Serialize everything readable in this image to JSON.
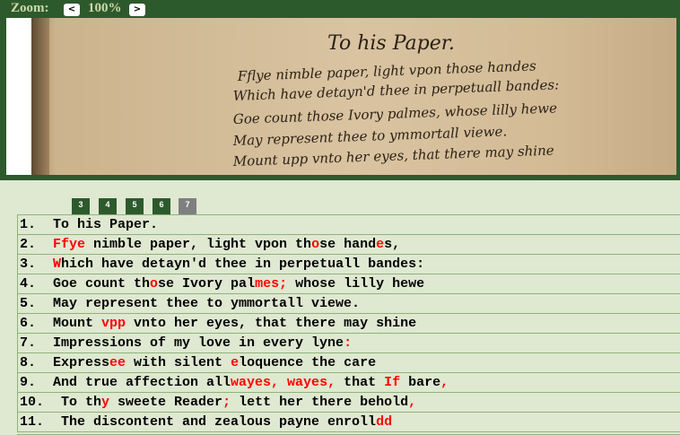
{
  "zoom": {
    "label": "Zoom:",
    "decrease": "<",
    "value": "100%",
    "increase": ">"
  },
  "manuscript": {
    "title": "To his Paper.",
    "handwriting": [
      "Fflye nimble paper, light vpon those handes",
      "Which have detayn'd thee in perpetuall bandes:",
      "Goe count those Ivory palmes, whose lilly hewe",
      "May represent thee to ymmortall viewe.",
      "Mount upp vnto her eyes, that there may shine"
    ]
  },
  "pages": [
    "3",
    "4",
    "5",
    "6",
    "7"
  ],
  "active_page": "7",
  "colors": {
    "toolbar": "#2d5a2d",
    "background": "#dfe8d1",
    "rule": "#8fb478",
    "edit": "#ff0000"
  },
  "lines": [
    {
      "num": "1.",
      "segs": [
        {
          "t": "To his Paper."
        }
      ]
    },
    {
      "num": "2.",
      "segs": [
        {
          "t": "Ffye",
          "r": true
        },
        {
          "t": " nimble paper, light vpon th"
        },
        {
          "t": "o",
          "r": true
        },
        {
          "t": "se hand"
        },
        {
          "t": "e",
          "r": true
        },
        {
          "t": "s,"
        }
      ]
    },
    {
      "num": "3.",
      "segs": [
        {
          "t": "W",
          "r": true
        },
        {
          "t": "hich have detayn'd thee in perpetuall bandes:"
        }
      ]
    },
    {
      "num": "4.",
      "segs": [
        {
          "t": "Goe count th"
        },
        {
          "t": "o",
          "r": true
        },
        {
          "t": "se Ivory pal"
        },
        {
          "t": "mes;",
          "r": true
        },
        {
          "t": " whose lilly hewe"
        }
      ]
    },
    {
      "num": "5.",
      "segs": [
        {
          "t": "May represent thee to ymmortall viewe."
        }
      ]
    },
    {
      "num": "6.",
      "segs": [
        {
          "t": "Mount "
        },
        {
          "t": "vpp",
          "r": true
        },
        {
          "t": " vnto her eyes, that there may shine"
        }
      ]
    },
    {
      "num": "7.",
      "segs": [
        {
          "t": "Impressions of my love in every lyne"
        },
        {
          "t": ":",
          "r": true
        }
      ]
    },
    {
      "num": "8.",
      "segs": [
        {
          "t": "Express"
        },
        {
          "t": "ee",
          "r": true
        },
        {
          "t": " with silent "
        },
        {
          "t": "e",
          "r": true
        },
        {
          "t": "loquence the care"
        }
      ]
    },
    {
      "num": "9.",
      "segs": [
        {
          "t": "And true affection all"
        },
        {
          "t": "wayes, wayes,",
          "r": true
        },
        {
          "t": " that "
        },
        {
          "t": "If",
          "r": true
        },
        {
          "t": " bare"
        },
        {
          "t": ",",
          "r": true
        }
      ]
    },
    {
      "num": "10.",
      "segs": [
        {
          "t": "To th"
        },
        {
          "t": "y",
          "r": true
        },
        {
          "t": " sweete Reader"
        },
        {
          "t": ";",
          "r": true
        },
        {
          "t": " lett her there behold"
        },
        {
          "t": ",",
          "r": true
        }
      ]
    },
    {
      "num": "11.",
      "segs": [
        {
          "t": "The discontent and zealous payne enroll"
        },
        {
          "t": "d",
          "r": true
        },
        {
          "t": "d",
          "r": true
        }
      ]
    }
  ]
}
